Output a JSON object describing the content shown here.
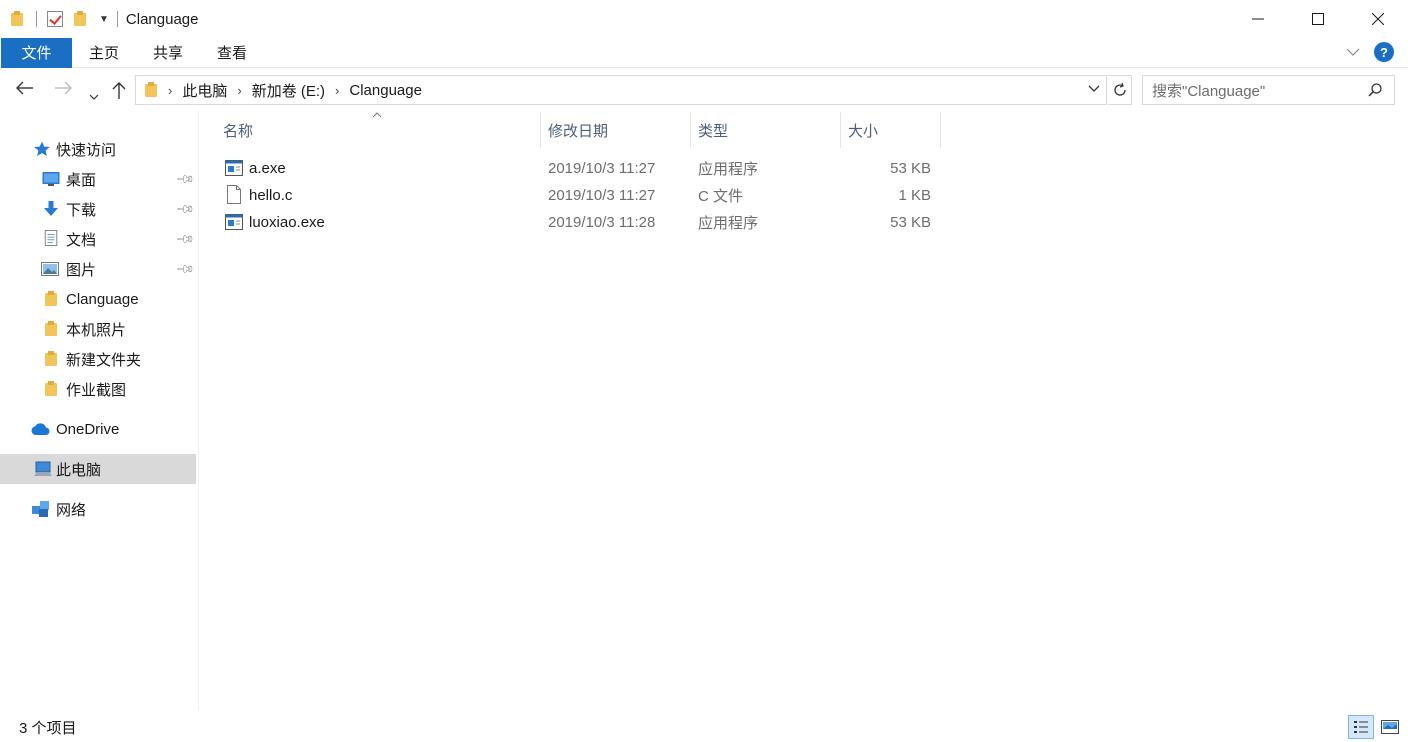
{
  "window": {
    "title": "Clanguage",
    "minimize": "—",
    "maximize": "☐",
    "close": "✕"
  },
  "ribbon": {
    "tabs": [
      {
        "label": "文件"
      },
      {
        "label": "主页"
      },
      {
        "label": "共享"
      },
      {
        "label": "查看"
      }
    ],
    "help": "?"
  },
  "address": {
    "breadcrumbs": [
      "此电脑",
      "新加卷 (E:)",
      "Clanguage"
    ],
    "search_placeholder": "搜索\"Clanguage\""
  },
  "nav": {
    "quick_access": "快速访问",
    "items": [
      {
        "label": "桌面",
        "icon": "desktop-icon",
        "pinned": true
      },
      {
        "label": "下载",
        "icon": "download-icon",
        "pinned": true
      },
      {
        "label": "文档",
        "icon": "document-icon",
        "pinned": true
      },
      {
        "label": "图片",
        "icon": "pictures-icon",
        "pinned": true
      },
      {
        "label": "Clanguage",
        "icon": "folder-icon",
        "pinned": false
      },
      {
        "label": "本机照片",
        "icon": "folder-icon",
        "pinned": false
      },
      {
        "label": "新建文件夹",
        "icon": "folder-icon",
        "pinned": false
      },
      {
        "label": "作业截图",
        "icon": "folder-icon",
        "pinned": false
      }
    ],
    "onedrive": "OneDrive",
    "this_pc": "此电脑",
    "network": "网络",
    "selected": "此电脑"
  },
  "columns": {
    "name": "名称",
    "date": "修改日期",
    "type": "类型",
    "size": "大小"
  },
  "files": [
    {
      "name": "a.exe",
      "date": "2019/10/3 11:27",
      "type": "应用程序",
      "size": "53 KB",
      "icon": "exe-icon"
    },
    {
      "name": "hello.c",
      "date": "2019/10/3 11:27",
      "type": "C 文件",
      "size": "1 KB",
      "icon": "file-icon"
    },
    {
      "name": "luoxiao.exe",
      "date": "2019/10/3 11:28",
      "type": "应用程序",
      "size": "53 KB",
      "icon": "exe-icon"
    }
  ],
  "status": {
    "item_count": "3 个项目"
  },
  "colors": {
    "accent": "#1a6fc2",
    "folder": "#f2c55a",
    "selected_nav": "#d9d9d9"
  }
}
